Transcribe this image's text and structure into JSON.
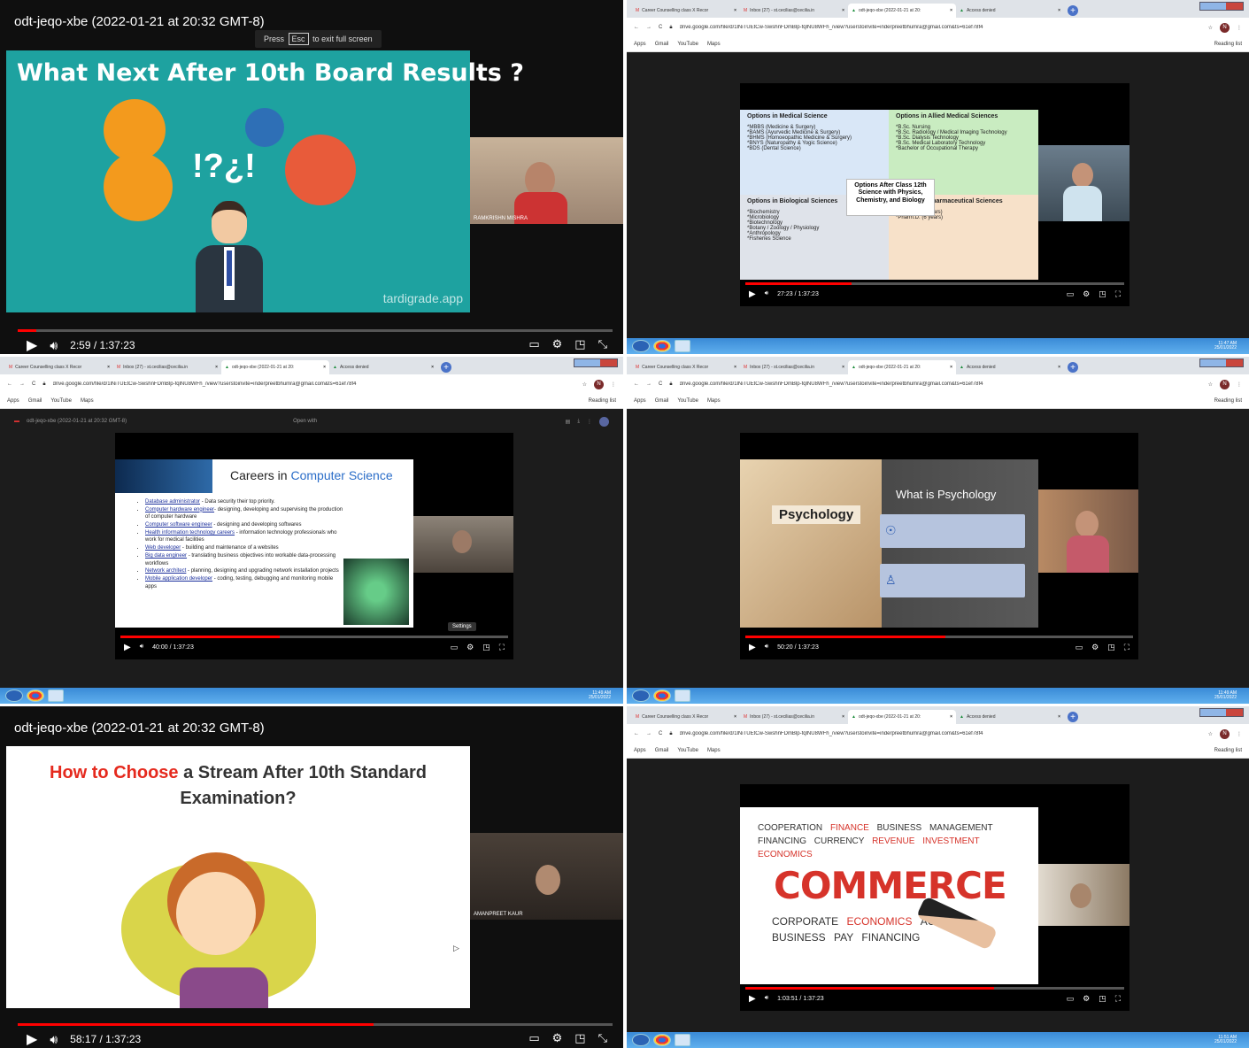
{
  "tile1": {
    "title": "odt-jeqo-xbe (2022-01-21 at 20:32 GMT-8)",
    "esc_prefix": "Press",
    "esc_key": "Esc",
    "esc_suffix": "to exit full screen",
    "slide_title": "What Next After 10th Board Results ?",
    "watermark": "tardigrade.app",
    "participant": "RAMKRISHN MISHRA",
    "time": "2:59 / 1:37:23",
    "progress": 0.031
  },
  "chrome": {
    "tabs": [
      "Career Counselling class X Recor",
      "Inbox (27) - st.cecilias@cecilia.in",
      "odt-jeqo-xbe (2022-01-21 at 20:",
      "Access denied"
    ],
    "url": "drive.google.com/file/d/1lNiTUEtCw-SwshnFDmBlp-fqlNU8WFh_/view?userstoinvite=inderpreetbhumra@gmail.com&ts=61ef78f4",
    "avatar_letter": "N",
    "bookmarks": [
      "Apps",
      "Gmail",
      "YouTube",
      "Maps"
    ],
    "reading_list": "Reading list"
  },
  "tile2": {
    "q1_title": "Options in Medical Science",
    "q1_items": [
      "*MBBS (Medicine & Surgery)",
      "*BAMS (Ayurvedic Medicine & Surgery)",
      "*BHMS (Homoeopathic Medicine & Surgery)",
      "*BNYS (Naturopathy & Yogic Science)",
      "*BDS (Dental Science)"
    ],
    "q2_title": "Options in Allied Medical Sciences",
    "q2_items": [
      "*B.Sc. Nursing",
      "*B.Sc. Radiology / Medical Imaging Technology",
      "*B.Sc. Dialysis Technology",
      "*B.Sc. Medical Laboratory Technology",
      "*Bachelor of Occupational Therapy"
    ],
    "q3_title": "Options in Biological Sciences",
    "q3_items": [
      "*Biochemistry",
      "*Microbiology",
      "*Biotechnology",
      "*Botany / Zoology / Physiology",
      "*Anthropology",
      "*Fisheries Science"
    ],
    "q4_title": "Options in Pharmaceutical Sciences",
    "q4_items": [
      "*B.Pharm. (4 years)",
      "*Pharm.D. (6 years)"
    ],
    "center": "Options After Class 12th Science with Physics, Chemistry, and Biology",
    "time": "27:23 / 1:37:23",
    "progress": 0.281,
    "clock_time": "11:47 AM",
    "clock_date": "25/01/2022"
  },
  "tile3": {
    "slide_title_a": "Careers in ",
    "slide_title_b": "Computer Science",
    "items": [
      {
        "link": "Database administrator",
        "text": " - Data security their top priority."
      },
      {
        "link": "Computer hardware engineer",
        "text": "- designing, developing and supervising the production of computer hardware"
      },
      {
        "link": "Computer software engineer",
        "text": " - designing and developing softwares"
      },
      {
        "link": "Health information technology careers",
        "text": " - information technology professionals who work for medical facilities"
      },
      {
        "link": "Web developer",
        "text": " - building and maintenance of a websites"
      },
      {
        "link": "Big data engineer",
        "text": " - translating business objectives into workable data-processing workflows"
      },
      {
        "link": "Network architect",
        "text": " - planning, designing and upgrading network installation projects"
      },
      {
        "link": "Mobile application developer",
        "text": " - coding, testing, debugging and monitoring mobile apps"
      }
    ],
    "header_title": "odt-jeqo-xbe (2022-01-21 at 20:32 GMT-8)",
    "open_with": "Open with",
    "settings_tip": "Settings",
    "time": "40:00 / 1:37:23",
    "progress": 0.411,
    "clock_time": "11:49 AM",
    "clock_date": "25/01/2022"
  },
  "tile4": {
    "label": "Psychology",
    "heading": "What is Psychology",
    "time": "50:20 / 1:37:23",
    "progress": 0.517,
    "clock_time": "11:49 AM",
    "clock_date": "25/01/2022"
  },
  "tile5": {
    "title": "odt-jeqo-xbe (2022-01-21 at 20:32 GMT-8)",
    "slide_title_red": "How to Choose",
    "slide_title_rest": " a Stream After 10th Standard",
    "slide_title_line2": "Examination?",
    "participant": "AMANPREET KAUR",
    "time": "58:17 / 1:37:23",
    "progress": 0.598
  },
  "tile6": {
    "big_word": "COMMERCE",
    "words": [
      "COOPERATION",
      "FINANCE",
      "BUSINESS",
      "MANAGEMENT",
      "FINANCING",
      "CURRENCY",
      "REVENUE",
      "INVESTMENT",
      "ECONOMICS",
      "CORPORATE",
      "ECONOMICS",
      "ACCESS",
      "BUSINESS",
      "PAY",
      "FINANCING"
    ],
    "time": "1:03:51 / 1:37:23",
    "progress": 0.656,
    "clock_time": "11:51 AM",
    "clock_date": "25/01/2022"
  }
}
